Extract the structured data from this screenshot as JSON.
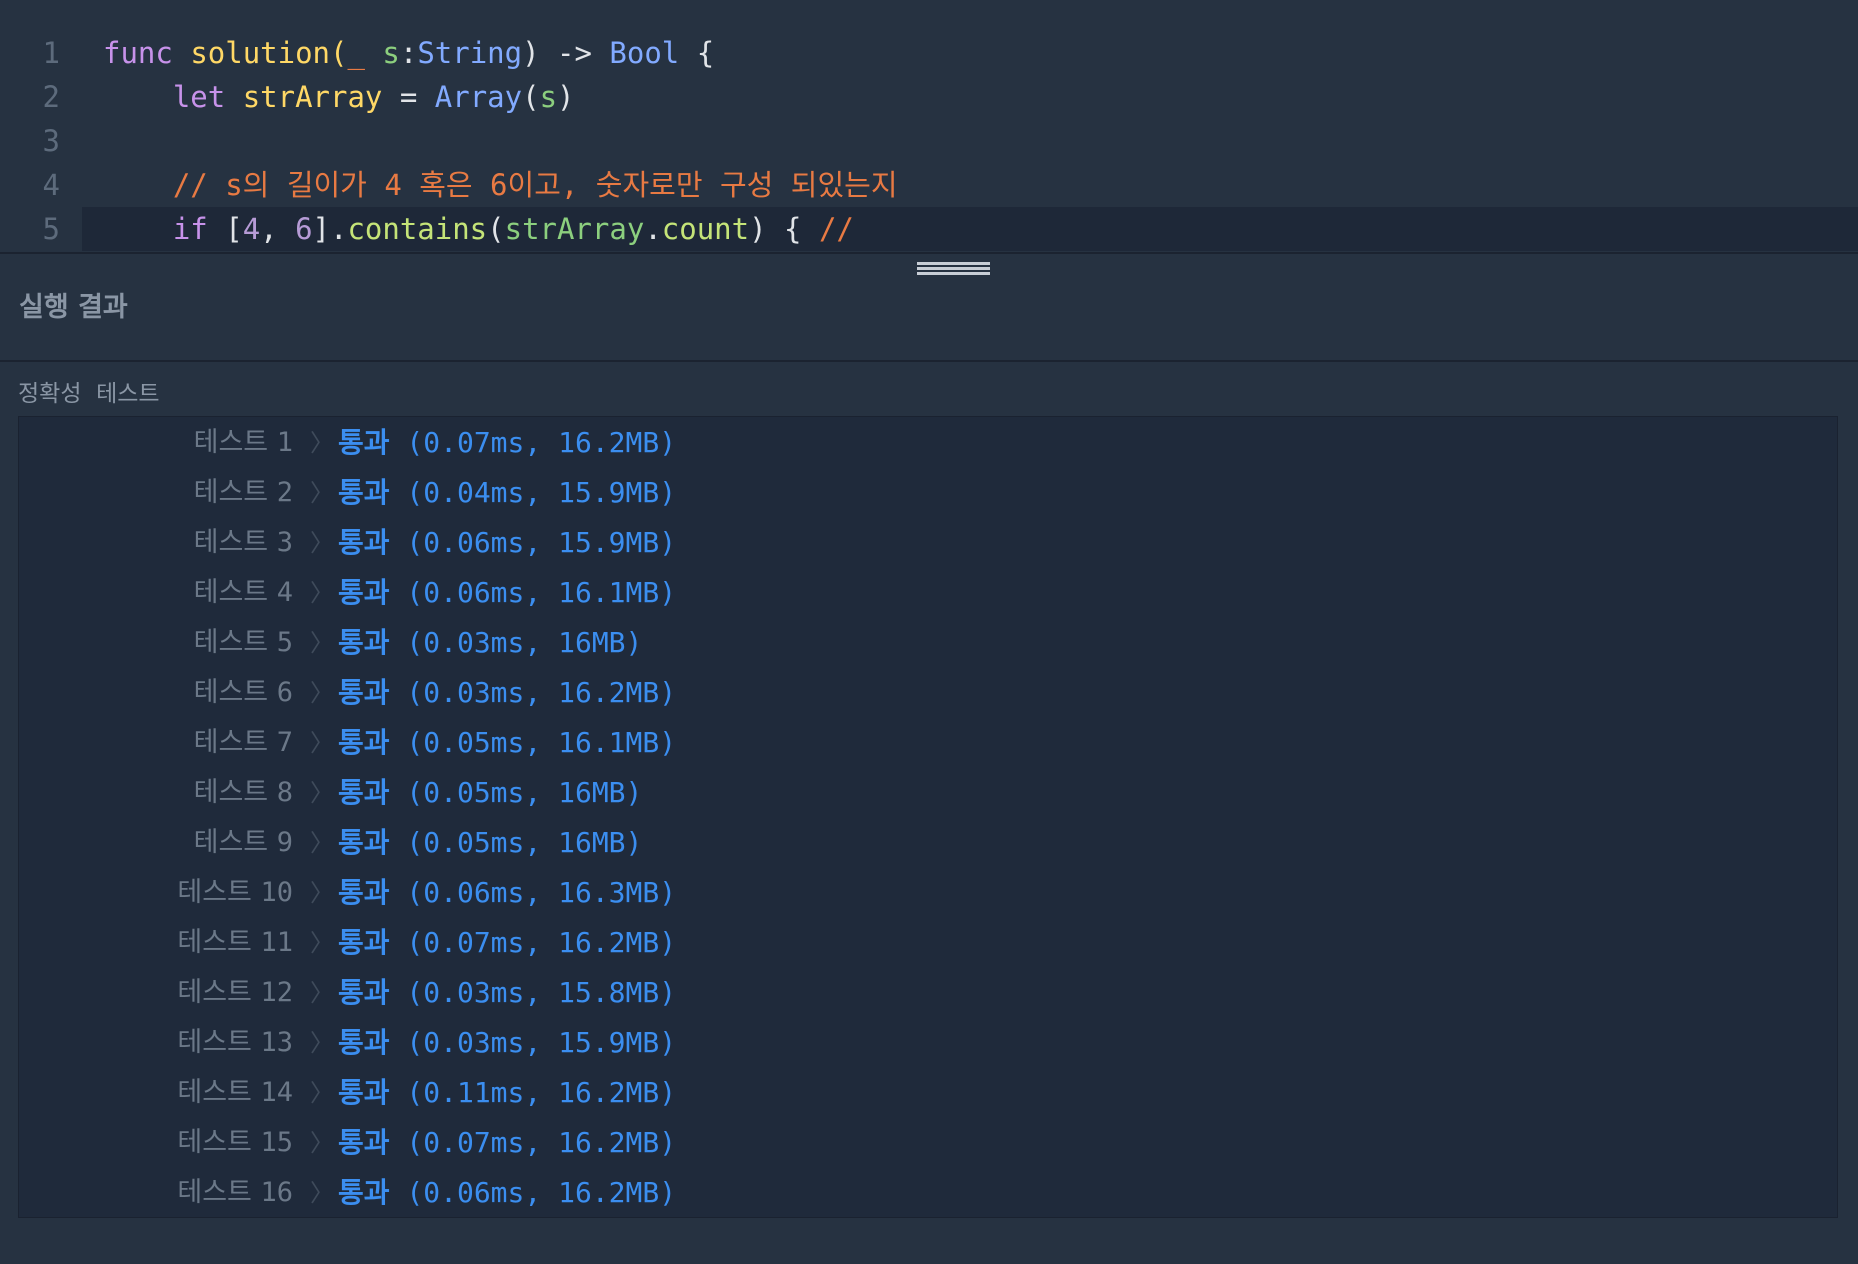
{
  "editor": {
    "lines": [
      {
        "num": "1",
        "tokens": [
          {
            "t": "func",
            "c": "kw"
          },
          {
            "t": " ",
            "c": "pl"
          },
          {
            "t": "solution",
            "c": "fn"
          },
          {
            "t": "(",
            "c": "fn"
          },
          {
            "t": "_",
            "c": "cm"
          },
          {
            "t": " ",
            "c": "pl"
          },
          {
            "t": "s",
            "c": "gn"
          },
          {
            "t": ":",
            "c": "pl"
          },
          {
            "t": "String",
            "c": "ty"
          },
          {
            "t": ") ",
            "c": "pl"
          },
          {
            "t": "->",
            "c": "op"
          },
          {
            "t": " ",
            "c": "pl"
          },
          {
            "t": "Bool",
            "c": "ty"
          },
          {
            "t": " {",
            "c": "pl"
          }
        ]
      },
      {
        "num": "2",
        "tokens": [
          {
            "t": "    ",
            "c": "pl"
          },
          {
            "t": "let",
            "c": "kw"
          },
          {
            "t": " ",
            "c": "pl"
          },
          {
            "t": "strArray",
            "c": "fn"
          },
          {
            "t": " = ",
            "c": "pl"
          },
          {
            "t": "Array",
            "c": "ty"
          },
          {
            "t": "(",
            "c": "pl"
          },
          {
            "t": "s",
            "c": "gn"
          },
          {
            "t": ")",
            "c": "pl"
          }
        ]
      },
      {
        "num": "3",
        "tokens": []
      },
      {
        "num": "4",
        "tokens": [
          {
            "t": "    ",
            "c": "pl"
          },
          {
            "t": "// s의 길이가 4 혹은 6이고, 숫자로만 구성 되있는지",
            "c": "cm"
          }
        ]
      },
      {
        "num": "5",
        "active": true,
        "tokens": [
          {
            "t": "    ",
            "c": "pl"
          },
          {
            "t": "if",
            "c": "kw"
          },
          {
            "t": " [",
            "c": "pl"
          },
          {
            "t": "4",
            "c": "nu"
          },
          {
            "t": ", ",
            "c": "pl"
          },
          {
            "t": "6",
            "c": "nu"
          },
          {
            "t": "].",
            "c": "pl"
          },
          {
            "t": "contains",
            "c": "pr"
          },
          {
            "t": "(",
            "c": "pl"
          },
          {
            "t": "strArray",
            "c": "gn"
          },
          {
            "t": ".",
            "c": "pl"
          },
          {
            "t": "count",
            "c": "pr"
          },
          {
            "t": ") { ",
            "c": "pl"
          },
          {
            "t": "//",
            "c": "cm"
          }
        ]
      }
    ]
  },
  "result_panel": {
    "title": "실행 결과",
    "section_label": "정확성  테스트",
    "test_label": "테스트",
    "tests": [
      {
        "num": "1",
        "status": "통과",
        "detail": " (0.07ms, 16.2MB)"
      },
      {
        "num": "2",
        "status": "통과",
        "detail": " (0.04ms, 15.9MB)"
      },
      {
        "num": "3",
        "status": "통과",
        "detail": " (0.06ms, 15.9MB)"
      },
      {
        "num": "4",
        "status": "통과",
        "detail": " (0.06ms, 16.1MB)"
      },
      {
        "num": "5",
        "status": "통과",
        "detail": " (0.03ms, 16MB)"
      },
      {
        "num": "6",
        "status": "통과",
        "detail": " (0.03ms, 16.2MB)"
      },
      {
        "num": "7",
        "status": "통과",
        "detail": " (0.05ms, 16.1MB)"
      },
      {
        "num": "8",
        "status": "통과",
        "detail": " (0.05ms, 16MB)"
      },
      {
        "num": "9",
        "status": "통과",
        "detail": " (0.05ms, 16MB)"
      },
      {
        "num": "10",
        "status": "통과",
        "detail": " (0.06ms, 16.3MB)"
      },
      {
        "num": "11",
        "status": "통과",
        "detail": " (0.07ms, 16.2MB)"
      },
      {
        "num": "12",
        "status": "통과",
        "detail": " (0.03ms, 15.8MB)"
      },
      {
        "num": "13",
        "status": "통과",
        "detail": " (0.03ms, 15.9MB)"
      },
      {
        "num": "14",
        "status": "통과",
        "detail": " (0.11ms, 16.2MB)"
      },
      {
        "num": "15",
        "status": "통과",
        "detail": " (0.07ms, 16.2MB)"
      },
      {
        "num": "16",
        "status": "통과",
        "detail": " (0.06ms, 16.2MB)"
      }
    ]
  },
  "icons": {
    "chevron": "chevron-right-icon",
    "resize": "resize-handle-icon"
  },
  "colors": {
    "background": "#263241",
    "panel": "#1f2a3b",
    "pass": "#3b8ef0"
  }
}
